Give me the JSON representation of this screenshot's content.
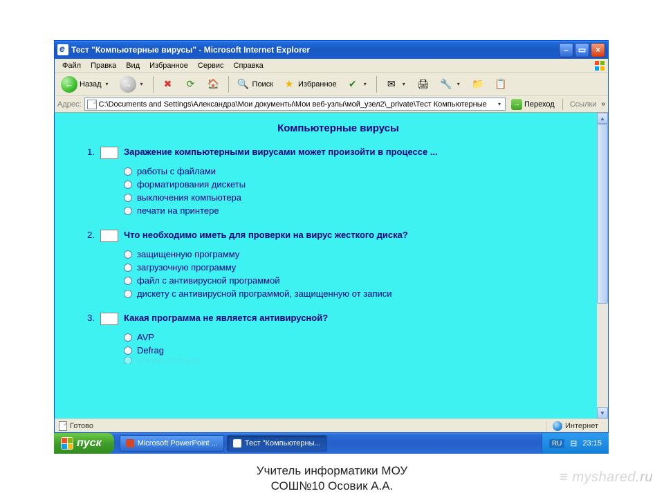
{
  "window": {
    "title": "Тест \"Компьютерные вирусы\" - Microsoft Internet Explorer"
  },
  "menu": {
    "file": "Файл",
    "edit": "Правка",
    "view": "Вид",
    "favorites": "Избранное",
    "tools": "Сервис",
    "help": "Справка"
  },
  "toolbar": {
    "back": "Назад",
    "search": "Поиск",
    "favorites": "Избранное"
  },
  "address": {
    "label": "Адрес:",
    "value": "C:\\Documents and Settings\\Александра\\Мои документы\\Мои веб-узлы\\мой_узел2\\_private\\Тест Компьютерные",
    "go": "Переход",
    "links": "Ссылки"
  },
  "page": {
    "title": "Компьютерные вирусы",
    "questions": [
      {
        "num": "1.",
        "text": "Заражение компьютерными вирусами может произойти в процессе ...",
        "options": [
          "работы с файлами",
          "форматирования дискеты",
          "выключения компьютера",
          "печати на принтере"
        ]
      },
      {
        "num": "2.",
        "text": "Что необходимо иметь для проверки на вирус жесткого диска?",
        "options": [
          "защищенную программу",
          "загрузочную программу",
          "файл с антивирусной программой",
          "дискету с антивирусной программой, защищенную от записи"
        ]
      },
      {
        "num": "3.",
        "text": "Какая программа не является антивирусной?",
        "options": [
          "AVP",
          "Defrag",
          "Norton Antivirus"
        ]
      }
    ]
  },
  "status": {
    "ready": "Готово",
    "internet": "Интернет"
  },
  "taskbar": {
    "start": "пуск",
    "app1": "Microsoft PowerPoint ...",
    "app2": "Тест \"Компьютерны...",
    "lang": "RU",
    "time": "23:15"
  },
  "footer": {
    "line1": "Учитель информатики МОУ",
    "line2": "СОШ№10 Осовик А.А."
  },
  "watermark": "myshared"
}
